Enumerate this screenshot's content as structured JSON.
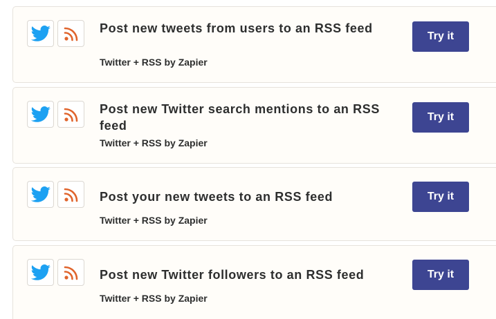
{
  "zaps": [
    {
      "title": "Post new tweets from users to an RSS feed",
      "byline": "Twitter + RSS by Zapier",
      "button_label": "Try it",
      "app_icons": [
        "twitter-icon",
        "rss-icon"
      ]
    },
    {
      "title": "Post new Twitter search mentions to an RSS feed",
      "byline": "Twitter + RSS by Zapier",
      "button_label": "Try it",
      "app_icons": [
        "twitter-icon",
        "rss-icon"
      ]
    },
    {
      "title": "Post your new tweets to an RSS feed",
      "byline": "Twitter + RSS by Zapier",
      "button_label": "Try it",
      "app_icons": [
        "twitter-icon",
        "rss-icon"
      ]
    },
    {
      "title": "Post new Twitter followers to an RSS feed",
      "byline": "Twitter + RSS by Zapier",
      "button_label": "Try it",
      "app_icons": [
        "twitter-icon",
        "rss-icon"
      ]
    }
  ],
  "colors": {
    "button": "#3d4592",
    "twitter": "#1da1f2",
    "rss": "#e0642c",
    "card_background": "#fffdf9",
    "text": "#2d2e2e"
  }
}
